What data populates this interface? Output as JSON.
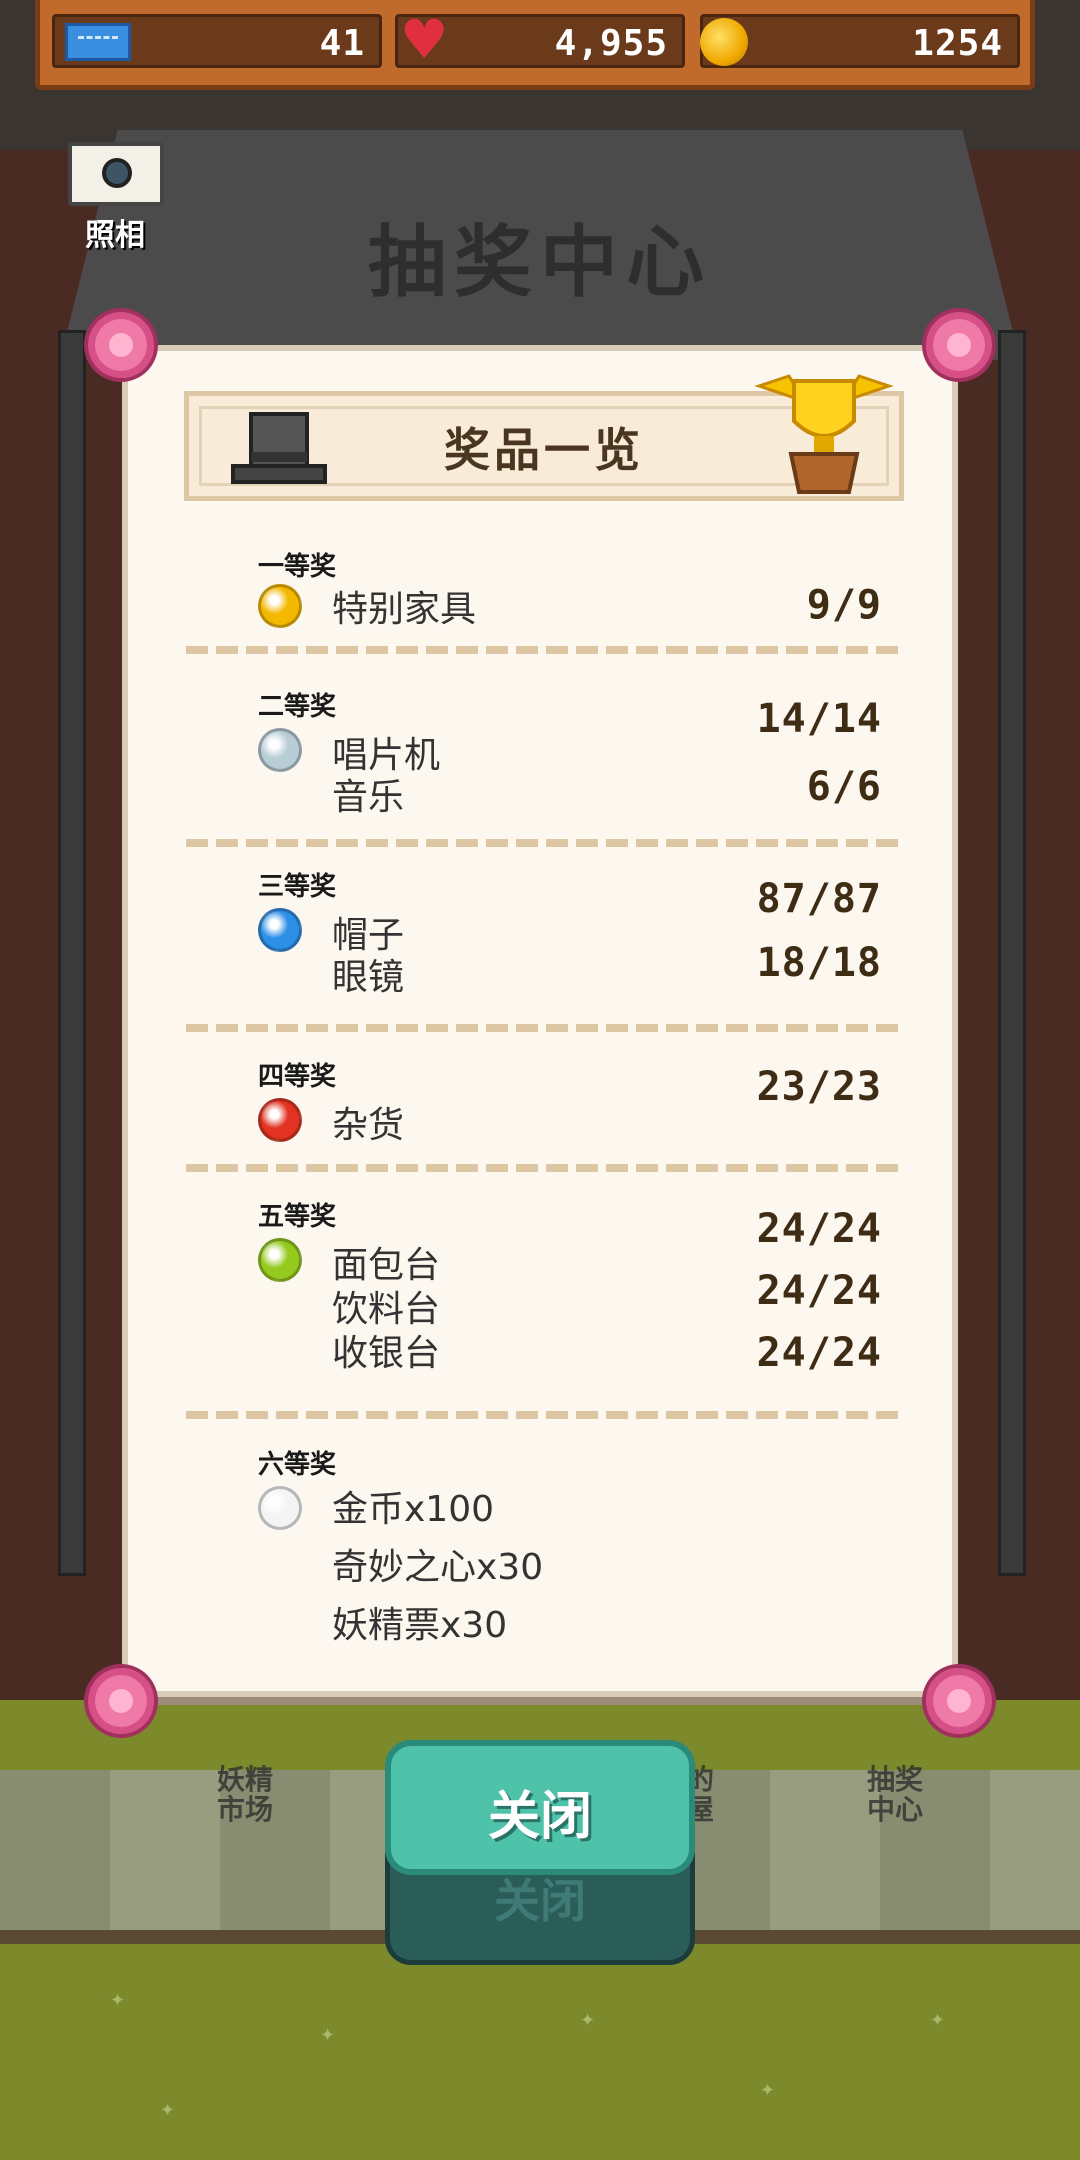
{
  "topbar": {
    "tickets": "41",
    "hearts": "4,955",
    "coins": "1254"
  },
  "camera": {
    "label": "照相"
  },
  "roof": {
    "title": "抽奖中心"
  },
  "panel": {
    "title": "奖品一览",
    "tiers": [
      {
        "label": "一等奖",
        "orb_color": "#f5b800",
        "items": [
          "特别家具"
        ],
        "counts": [
          "9/9"
        ]
      },
      {
        "label": "二等奖",
        "orb_color": "#b8cdd6",
        "items": [
          "唱片机",
          "音乐"
        ],
        "counts": [
          "14/14",
          "6/6"
        ]
      },
      {
        "label": "三等奖",
        "orb_color": "#2e8fe6",
        "items": [
          "帽子",
          "眼镜"
        ],
        "counts": [
          "87/87",
          "18/18"
        ]
      },
      {
        "label": "四等奖",
        "orb_color": "#e23322",
        "items": [
          "杂货"
        ],
        "counts": [
          "23/23"
        ]
      },
      {
        "label": "五等奖",
        "orb_color": "#94c91e",
        "items": [
          "面包台",
          "饮料台",
          "收银台"
        ],
        "counts": [
          "24/24",
          "24/24",
          "24/24"
        ]
      },
      {
        "label": "六等奖",
        "orb_color": "#f4f4f4",
        "items": [
          "金币x100",
          "奇妙之心x30",
          "妖精票x30"
        ],
        "counts": []
      }
    ]
  },
  "background_labels": {
    "shop1": "妖精\n市场",
    "shop3": "的\n屋",
    "shop4": "抽奖\n中心"
  },
  "close_button": {
    "label": "关闭"
  },
  "colors": {
    "accent_teal": "#4fc3aa",
    "panel_bg": "#fcf7ef",
    "topbar": "#c06a2c"
  }
}
